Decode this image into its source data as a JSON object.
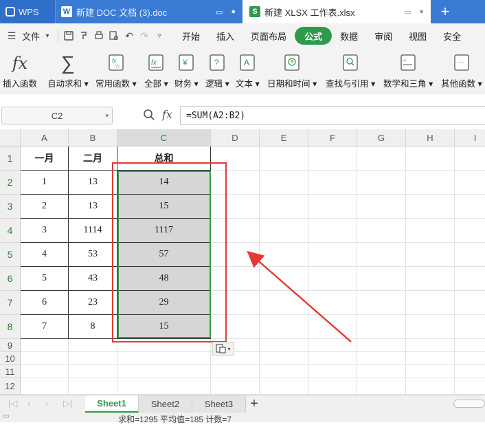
{
  "tabs": {
    "app": "WPS",
    "doc_title": "新建 DOC 文档 (3).doc",
    "xlsx_title": "新建 XLSX 工作表.xlsx",
    "new_tab": "+"
  },
  "menu": {
    "file": "文件",
    "items": [
      "开始",
      "插入",
      "页面布局",
      "公式",
      "数据",
      "审阅",
      "视图",
      "安全"
    ],
    "active": "公式"
  },
  "ribbon": {
    "items": [
      {
        "label": "插入函数",
        "icon": "fx-icon"
      },
      {
        "label": "自动求和",
        "icon": "sigma-icon"
      },
      {
        "label": "常用函数",
        "icon": "star-fx-icon"
      },
      {
        "label": "全部",
        "icon": "fx-book-icon"
      },
      {
        "label": "财务",
        "icon": "yen-book-icon"
      },
      {
        "label": "逻辑",
        "icon": "question-book-icon"
      },
      {
        "label": "文本",
        "icon": "a-book-icon"
      },
      {
        "label": "日期和时间",
        "icon": "clock-book-icon"
      },
      {
        "label": "查找与引用",
        "icon": "search-book-icon"
      },
      {
        "label": "数学和三角",
        "icon": "math-book-icon"
      },
      {
        "label": "其他函数",
        "icon": "dots-book-icon"
      }
    ]
  },
  "formula_bar": {
    "name_box": "C2",
    "fx": "fx",
    "formula": "=SUM(A2:B2)"
  },
  "grid": {
    "columns": [
      "A",
      "B",
      "C",
      "D",
      "E",
      "F",
      "G",
      "H",
      "I"
    ],
    "rows": [
      "1",
      "2",
      "3",
      "4",
      "5",
      "6",
      "7",
      "8",
      "9",
      "10",
      "11",
      "12"
    ],
    "header_row": [
      "一月",
      "二月",
      "总和"
    ],
    "data": [
      [
        "1",
        "13",
        "14"
      ],
      [
        "2",
        "13",
        "15"
      ],
      [
        "3",
        "1114",
        "1117"
      ],
      [
        "4",
        "53",
        "57"
      ],
      [
        "5",
        "43",
        "48"
      ],
      [
        "6",
        "23",
        "29"
      ],
      [
        "7",
        "8",
        "15"
      ]
    ]
  },
  "sheets": [
    "Sheet1",
    "Sheet2",
    "Sheet3"
  ],
  "active_sheet": "Sheet1",
  "status": "求和=1295  平均值=185  计数=7",
  "colors": {
    "accent_green": "#2e9a4c",
    "tab_blue": "#3a7bd5",
    "annotation_red": "#e53935"
  }
}
